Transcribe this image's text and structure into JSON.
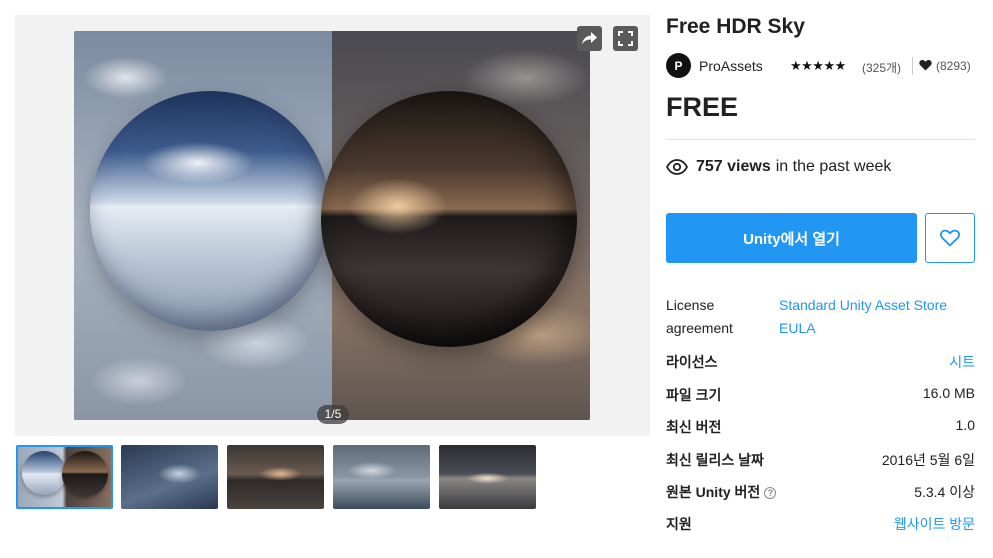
{
  "gallery": {
    "counter": "1/5",
    "share_icon": "share-icon",
    "fullscreen_icon": "fullscreen-icon",
    "thumbnail_count": 5
  },
  "product": {
    "title": "Free HDR Sky",
    "publisher": {
      "avatar_letter": "P",
      "name": "ProAssets"
    },
    "rating": {
      "stars": "★★★★★",
      "stars_value": 5,
      "count": "(325개)"
    },
    "favorites": "(8293)",
    "price": "FREE",
    "views": {
      "count": "757 views",
      "suffix": "in the past week"
    },
    "open_button": "Unity에서 열기",
    "wishlist_icon": "heart-outline-icon"
  },
  "details": {
    "license_agreement": {
      "label_line1": "License",
      "label_line2": "agreement",
      "value_line1": "Standard Unity Asset Store",
      "value_line2": "EULA"
    },
    "license": {
      "label": "라이선스",
      "value": "시트"
    },
    "file_size": {
      "label": "파일 크기",
      "value": "16.0 MB"
    },
    "latest_version": {
      "label": "최신 버전",
      "value": "1.0"
    },
    "latest_release": {
      "label": "최신 릴리스 날짜",
      "value": "2016년 5월 6일"
    },
    "original_unity_version": {
      "label": "원본 Unity 버전",
      "help": "?",
      "value": "5.3.4 이상"
    },
    "support": {
      "label": "지원",
      "value": "웹사이트 방문"
    }
  },
  "colors": {
    "accent": "#2196f3",
    "text": "#212121"
  }
}
